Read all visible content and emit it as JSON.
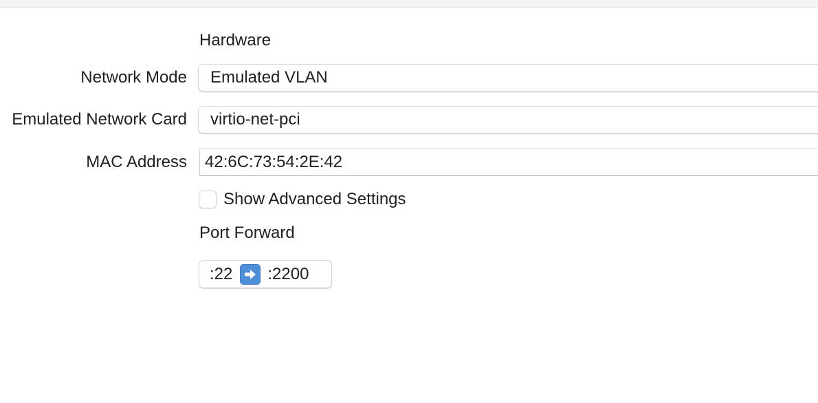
{
  "section": {
    "hardware_label": "Hardware",
    "port_forward_label": "Port Forward"
  },
  "fields": {
    "network_mode": {
      "label": "Network Mode",
      "value": "Emulated VLAN"
    },
    "network_card": {
      "label": "Emulated Network Card",
      "value": "virtio-net-pci"
    },
    "mac_address": {
      "label": "MAC Address",
      "value": "42:6C:73:54:2E:42"
    }
  },
  "advanced": {
    "label": "Show Advanced Settings",
    "checked": false
  },
  "port_forward": {
    "guest_port": ":22",
    "host_port": ":2200",
    "arrow_icon": "right-arrow-icon"
  }
}
